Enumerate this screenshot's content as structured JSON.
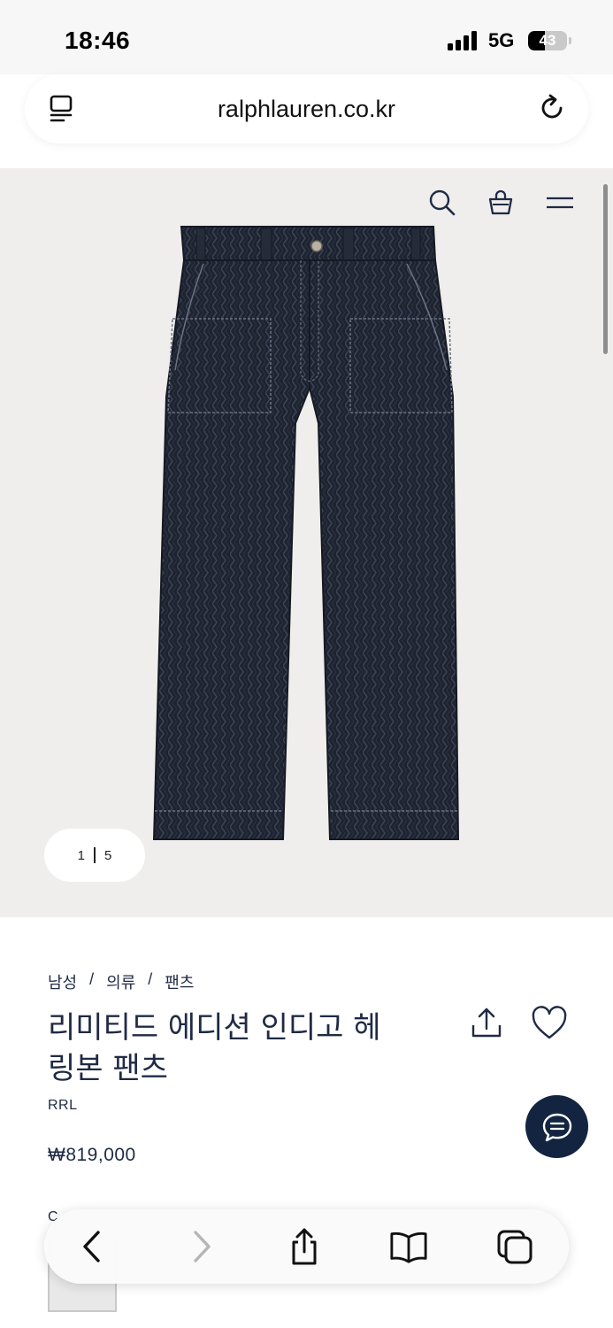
{
  "status_bar": {
    "time": "18:46",
    "network": "5G",
    "battery_level": "43",
    "battery_fraction": 0.43,
    "icons": [
      "signal-bars-icon",
      "battery-icon"
    ]
  },
  "browser": {
    "url": "ralphlauren.co.kr",
    "icons": [
      "reader-mode-icon",
      "reload-icon"
    ]
  },
  "header_icons": [
    "search-icon",
    "shopping-bag-icon",
    "menu-icon"
  ],
  "gallery": {
    "current": "1",
    "total": "5",
    "background": "#efeeec"
  },
  "product": {
    "breadcrumb": [
      "남성",
      "의류",
      "팬츠"
    ],
    "title": "리미티드 에디션 인디고 헤링본 팬츠",
    "title_lines": [
      "리미티드 에디션 인디고 헤",
      "링본 팬츠"
    ],
    "brand": "RRL",
    "price": "₩819,000",
    "color_label": "C"
  },
  "actions": [
    "share-icon",
    "heart-icon",
    "chat-icon"
  ],
  "toolbar": [
    "back-icon",
    "forward-icon",
    "share-icon",
    "bookmarks-icon",
    "tabs-icon"
  ],
  "colors": {
    "navy": "#1f2a44",
    "chat_button": "#132441"
  }
}
